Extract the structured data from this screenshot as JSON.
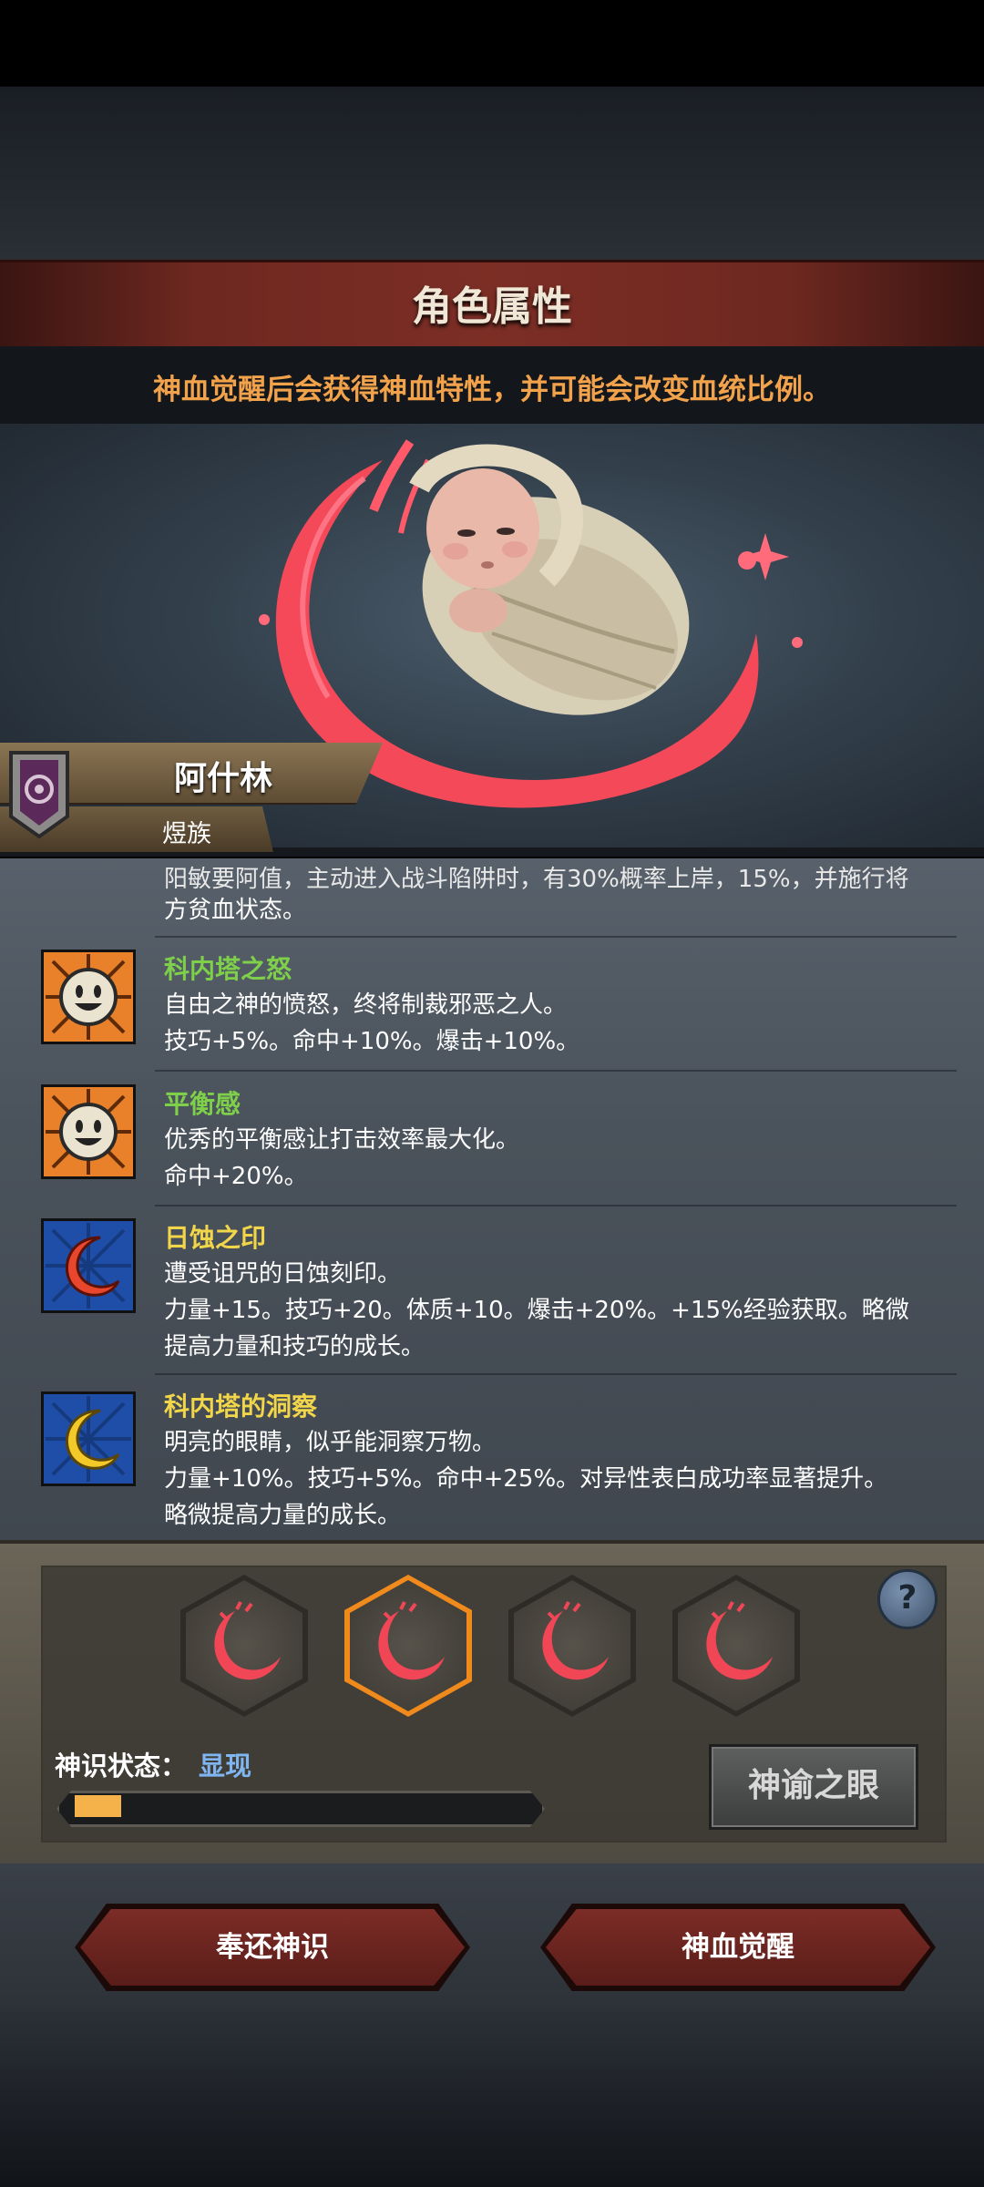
{
  "header": {
    "title": "角色属性",
    "subtitle": "神血觉醒后会获得神血特性，并可能会改变血统比例。"
  },
  "character": {
    "name": "阿什林",
    "race": "煜族"
  },
  "traits": [
    {
      "name": "",
      "name_color": "#ffffff",
      "icon": "smiley-sun-icon",
      "lines": [
        "阳敏要阿值，主动进入战斗陷阱时，有30%概率上岸，15%，并施行将",
        "方贫血状态。"
      ]
    },
    {
      "name": "科内塔之怒",
      "name_color": "#7ed04a",
      "icon": "smiley-sun-icon",
      "lines": [
        "自由之神的愤怒，终将制裁邪恶之人。",
        "技巧+5%。命中+10%。爆击+10%。"
      ]
    },
    {
      "name": "平衡感",
      "name_color": "#7ed04a",
      "icon": "smiley-sun-icon",
      "lines": [
        "优秀的平衡感让打击效率最大化。",
        "命中+20%。"
      ]
    },
    {
      "name": "日蚀之印",
      "name_color": "#f1d54a",
      "icon": "red-crescent-icon",
      "lines": [
        "遭受诅咒的日蚀刻印。",
        "力量+15。技巧+20。体质+10。爆击+20%。+15%经验获取。略微",
        "提高力量和技巧的成长。"
      ]
    },
    {
      "name": "科内塔的洞察",
      "name_color": "#f1d54a",
      "icon": "yellow-crescent-icon",
      "lines": [
        "明亮的眼睛，似乎能洞察万物。",
        "力量+10%。技巧+5%。命中+25%。对异性表白成功率显著提升。",
        "略微提高力量的成长。"
      ]
    }
  ],
  "awakening": {
    "slots": [
      {
        "icon": "red-crescent-icon",
        "selected": false
      },
      {
        "icon": "red-crescent-icon",
        "selected": true
      },
      {
        "icon": "red-crescent-icon",
        "selected": false
      },
      {
        "icon": "red-crescent-icon",
        "selected": false
      }
    ],
    "state_label": "神识状态：",
    "state_value": "显现",
    "progress": 0.1,
    "oracle_button": "神谕之眼",
    "help_icon": "help-icon"
  },
  "footer": {
    "return_button": "奉还神识",
    "awaken_button": "神血觉醒"
  },
  "colors": {
    "accent_orange": "#f2a24a",
    "banner_red": "#7c2e25",
    "state_blue": "#7fb6f2",
    "progress_fill": "#f5b24b"
  }
}
